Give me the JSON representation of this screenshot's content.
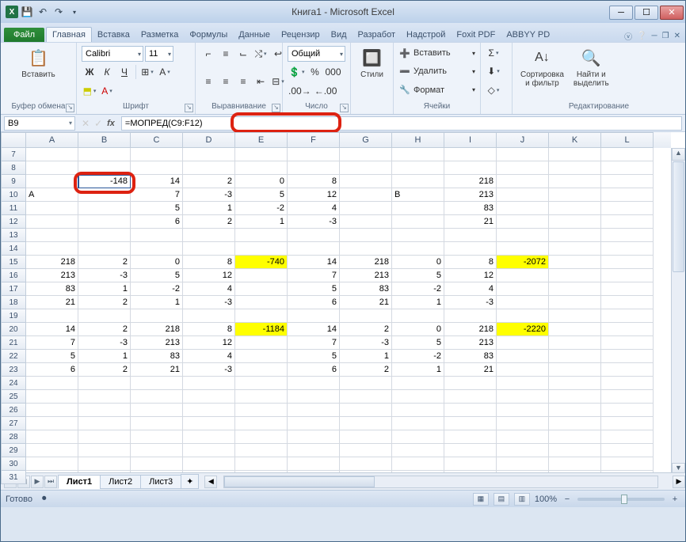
{
  "title": "Книга1 - Microsoft Excel",
  "tabs": {
    "file": "Файл",
    "items": [
      "Главная",
      "Вставка",
      "Разметка",
      "Формулы",
      "Данные",
      "Рецензир",
      "Вид",
      "Разработ",
      "Надстрой",
      "Foxit PDF",
      "ABBYY PD"
    ]
  },
  "ribbon": {
    "clipboard": {
      "paste": "Вставить",
      "label": "Буфер обмена"
    },
    "font": {
      "name": "Calibri",
      "size": "11",
      "label": "Шрифт"
    },
    "align": {
      "label": "Выравнивание"
    },
    "number": {
      "format": "Общий",
      "label": "Число"
    },
    "styles": {
      "styles": "Стили",
      "label": ""
    },
    "cells": {
      "insert": "Вставить",
      "delete": "Удалить",
      "format": "Формат",
      "label": "Ячейки"
    },
    "editing": {
      "sort": "Сортировка\nи фильтр",
      "find": "Найти и\nвыделить",
      "label": "Редактирование"
    }
  },
  "namebox": "B9",
  "formula": "=МОПРЕД(C9:F12)",
  "columns": [
    "A",
    "B",
    "C",
    "D",
    "E",
    "F",
    "G",
    "H",
    "I",
    "J",
    "K",
    "L"
  ],
  "rows": [
    "7",
    "8",
    "9",
    "10",
    "11",
    "12",
    "13",
    "14",
    "15",
    "16",
    "17",
    "18",
    "19",
    "20",
    "21",
    "22",
    "23",
    "24",
    "25",
    "26",
    "27",
    "28",
    "29",
    "30",
    "31"
  ],
  "sheets": {
    "s1": "Лист1",
    "s2": "Лист2",
    "s3": "Лист3"
  },
  "status": {
    "ready": "Готово",
    "zoom": "100%"
  },
  "data": {
    "r9": {
      "B": "-148",
      "C": "14",
      "D": "2",
      "E": "0",
      "F": "8",
      "I": "218"
    },
    "r10": {
      "A": "А",
      "C": "7",
      "D": "-3",
      "E": "5",
      "F": "12",
      "H": "B",
      "I": "213"
    },
    "r11": {
      "C": "5",
      "D": "1",
      "E": "-2",
      "F": "4",
      "I": "83"
    },
    "r12": {
      "C": "6",
      "D": "2",
      "E": "1",
      "F": "-3",
      "I": "21"
    },
    "r15": {
      "A": "218",
      "B": "2",
      "C": "0",
      "D": "8",
      "E": "-740",
      "F": "14",
      "G": "218",
      "H": "0",
      "I": "8",
      "J": "-2072"
    },
    "r16": {
      "A": "213",
      "B": "-3",
      "C": "5",
      "D": "12",
      "F": "7",
      "G": "213",
      "H": "5",
      "I": "12"
    },
    "r17": {
      "A": "83",
      "B": "1",
      "C": "-2",
      "D": "4",
      "F": "5",
      "G": "83",
      "H": "-2",
      "I": "4"
    },
    "r18": {
      "A": "21",
      "B": "2",
      "C": "1",
      "D": "-3",
      "F": "6",
      "G": "21",
      "H": "1",
      "I": "-3"
    },
    "r20": {
      "A": "14",
      "B": "2",
      "C": "218",
      "D": "8",
      "E": "-1184",
      "F": "14",
      "G": "2",
      "H": "0",
      "I": "218",
      "J": "-2220"
    },
    "r21": {
      "A": "7",
      "B": "-3",
      "C": "213",
      "D": "12",
      "F": "7",
      "G": "-3",
      "H": "5",
      "I": "213"
    },
    "r22": {
      "A": "5",
      "B": "1",
      "C": "83",
      "D": "4",
      "F": "5",
      "G": "1",
      "H": "-2",
      "I": "83"
    },
    "r23": {
      "A": "6",
      "B": "2",
      "C": "21",
      "D": "-3",
      "F": "6",
      "G": "2",
      "H": "1",
      "I": "21"
    }
  },
  "yellow": [
    "r15.E",
    "r15.J",
    "r20.E",
    "r20.J"
  ]
}
